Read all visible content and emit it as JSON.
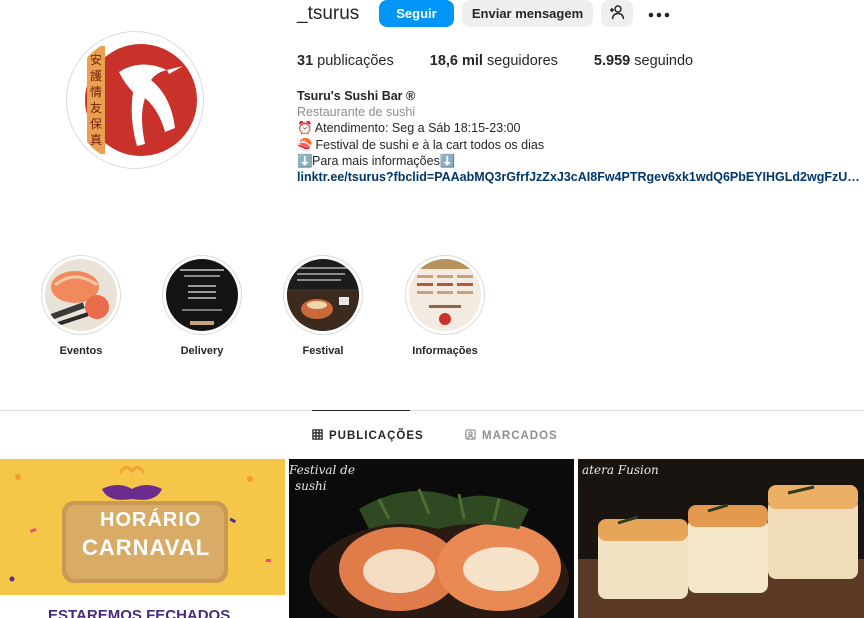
{
  "profile": {
    "username": "_tsurus",
    "follow_label": "Seguir",
    "message_label": "Enviar mensagem",
    "add_user_icon": "add-user-icon",
    "more_icon": "more-options-icon"
  },
  "stats": {
    "posts_count": "31",
    "posts_label": "publicações",
    "followers_count": "18,6 mil",
    "followers_label": "seguidores",
    "following_count": "5.959",
    "following_label": "seguindo"
  },
  "bio": {
    "name": "Tsuru's Sushi Bar ®",
    "category": "Restaurante de sushi",
    "line1_emoji": "⏰",
    "line1": "Atendimento: Seg a Sáb 18:15-23:00",
    "line2_emoji": "🍣",
    "line2": "Festival de sushi e à la cart todos os dias",
    "line3_emoji_start": "⬇️",
    "line3": "Para mais informações",
    "line3_emoji_end": "⬇️",
    "link": "linktr.ee/tsurus?fbclid=PAAabMQ3rGfrfJzZxJ3cAI8Fw4PTRgev6xk1wdQ6PbEYIHGLd2wgFzUW7..."
  },
  "highlights": [
    {
      "label": "Eventos"
    },
    {
      "label": "Delivery"
    },
    {
      "label": "Festival"
    },
    {
      "label": "Informações"
    }
  ],
  "tabs": {
    "posts": "PUBLICAÇÕES",
    "tagged": "MARCADOS"
  },
  "posts": [
    {
      "title_line1": "HORÁRIO",
      "title_line2": "CARNAVAL",
      "subtitle": "ESTAREMOS FECHADOS"
    },
    {
      "caption_line1": "Festival de",
      "caption_line2": "sushi"
    },
    {
      "caption": "atera Fusion"
    }
  ],
  "colors": {
    "primary": "#0095f6",
    "link": "#00376b",
    "brand_red": "#c8322b",
    "muted": "#8e8e8e"
  }
}
